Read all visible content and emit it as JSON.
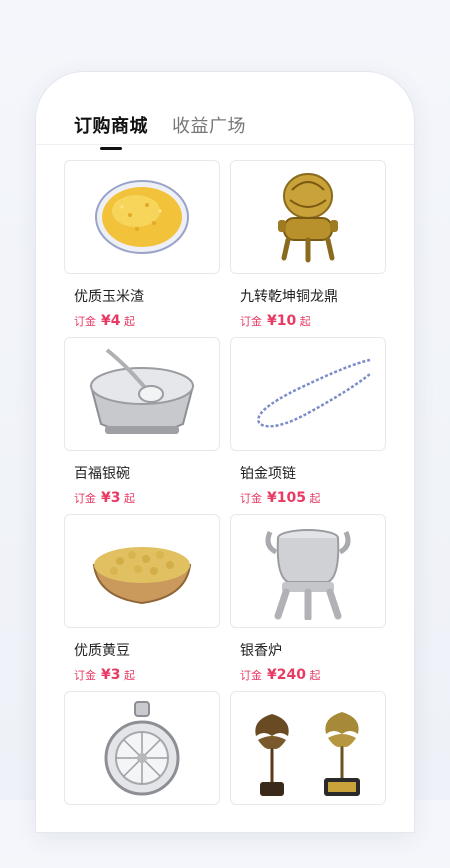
{
  "tabs": [
    {
      "label": "订购商城",
      "active": true
    },
    {
      "label": "收益广场",
      "active": false
    }
  ],
  "colors": {
    "accent": "#e83a63",
    "text": "#222222"
  },
  "products": [
    {
      "name": "优质玉米渣",
      "deposit_label": "订金",
      "price": "¥4",
      "suffix": "起",
      "icon": "corn-grits-bowl-icon"
    },
    {
      "name": "九转乾坤铜龙鼎",
      "deposit_label": "订金",
      "price": "¥10",
      "suffix": "起",
      "icon": "bronze-dragon-censer-icon"
    },
    {
      "name": "百福银碗",
      "deposit_label": "订金",
      "price": "¥3",
      "suffix": "起",
      "icon": "silver-bowl-icon"
    },
    {
      "name": "铂金项链",
      "deposit_label": "订金",
      "price": "¥105",
      "suffix": "起",
      "icon": "platinum-necklace-icon"
    },
    {
      "name": "优质黄豆",
      "deposit_label": "订金",
      "price": "¥3",
      "suffix": "起",
      "icon": "soybean-bowl-icon"
    },
    {
      "name": "银香炉",
      "deposit_label": "订金",
      "price": "¥240",
      "suffix": "起",
      "icon": "silver-censer-icon"
    },
    {
      "name": "",
      "icon": "silver-pendant-icon"
    },
    {
      "name": "",
      "icon": "bronze-trees-icon"
    }
  ]
}
